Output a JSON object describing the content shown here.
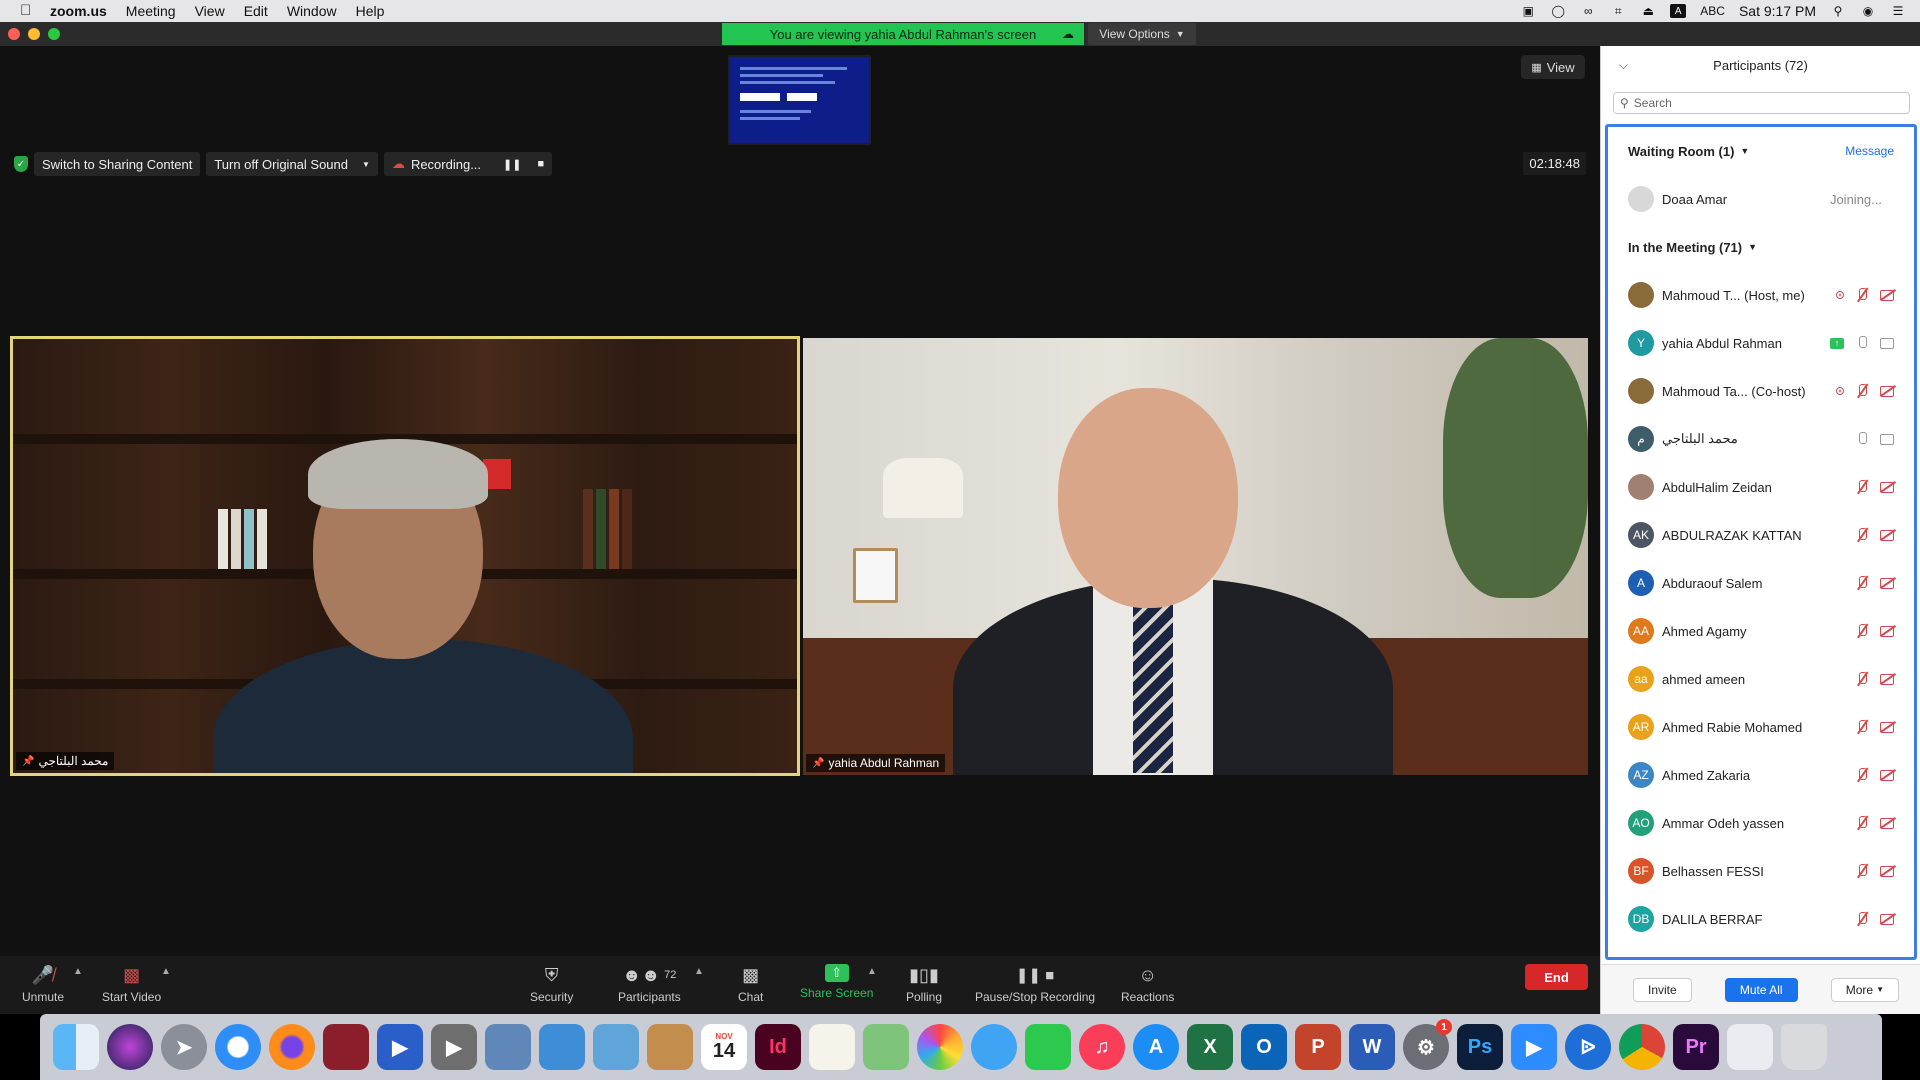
{
  "menubar": {
    "app_name": "zoom.us",
    "items": [
      "Meeting",
      "View",
      "Edit",
      "Window",
      "Help"
    ],
    "input_source": "ABC",
    "clock": "Sat 9:17 PM"
  },
  "share_bar": {
    "text": "You are viewing yahia Abdul Rahman's screen",
    "view_options": "View Options"
  },
  "main": {
    "view_button": "View",
    "switch_sharing": "Switch to Sharing Content",
    "original_sound": "Turn off Original Sound",
    "recording": "Recording...",
    "timer": "02:18:48"
  },
  "tiles": [
    {
      "name": "محمد البلتاجي"
    },
    {
      "name": "yahia Abdul Rahman"
    }
  ],
  "toolbar": {
    "unmute": "Unmute",
    "start_video": "Start Video",
    "security": "Security",
    "participants": "Participants",
    "participants_count": "72",
    "chat": "Chat",
    "share_screen": "Share Screen",
    "polling": "Polling",
    "recording": "Pause/Stop Recording",
    "reactions": "Reactions",
    "end": "End"
  },
  "panel": {
    "title": "Participants (72)",
    "search_placeholder": "Search",
    "waiting_room": "Waiting Room (1)",
    "message": "Message",
    "waiting": [
      {
        "name": "Doaa Amar",
        "status": "Joining..."
      }
    ],
    "in_meeting": "In the Meeting (71)",
    "participants": [
      {
        "initials": "",
        "name": "Mahmoud T...  (Host, me)",
        "color": "#8a6b3a"
      },
      {
        "initials": "Y",
        "name": "yahia Abdul Rahman",
        "color": "#1e9aa0"
      },
      {
        "initials": "",
        "name": "Mahmoud Ta...  (Co-host)",
        "color": "#8a6b3a"
      },
      {
        "initials": "م",
        "name": "محمد البلتاجي",
        "color": "#3e5c6a"
      },
      {
        "initials": "",
        "name": "AbdulHalim Zeidan",
        "color": "#a08070"
      },
      {
        "initials": "AK",
        "name": "ABDULRAZAK KATTAN",
        "color": "#4b5563"
      },
      {
        "initials": "A",
        "name": "Abduraouf Salem",
        "color": "#1d5fb3"
      },
      {
        "initials": "AA",
        "name": "Ahmed Agamy",
        "color": "#e0781c"
      },
      {
        "initials": "aa",
        "name": "ahmed ameen",
        "color": "#eaa21a"
      },
      {
        "initials": "AR",
        "name": "Ahmed Rabie Mohamed",
        "color": "#eaa21a"
      },
      {
        "initials": "AZ",
        "name": "Ahmed Zakaria",
        "color": "#3b86c6"
      },
      {
        "initials": "AO",
        "name": "Ammar Odeh yassen",
        "color": "#22a07a"
      },
      {
        "initials": "BF",
        "name": "Belhassen FESSI",
        "color": "#d9532b"
      },
      {
        "initials": "DB",
        "name": "DALILA BERRAF",
        "color": "#1ea3a3"
      }
    ],
    "invite": "Invite",
    "mute_all": "Mute All",
    "more": "More"
  },
  "dock": {
    "calendar_month": "NOV",
    "calendar_day": "14",
    "settings_badge": "1"
  }
}
